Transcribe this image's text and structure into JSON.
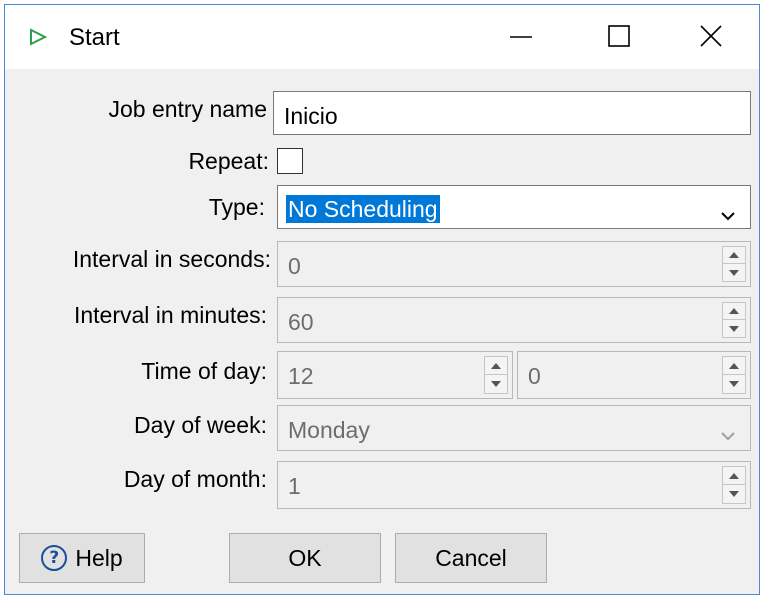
{
  "window": {
    "title": "Start",
    "controls": {
      "minimize": "minimize",
      "maximize": "maximize",
      "close": "close"
    }
  },
  "form": {
    "job_entry_name": {
      "label": "Job entry name",
      "value": "Inicio"
    },
    "repeat": {
      "label": "Repeat:",
      "checked": false
    },
    "type": {
      "label": "Type:",
      "value": "No Scheduling"
    },
    "interval_seconds": {
      "label": "Interval in seconds:",
      "value": "0"
    },
    "interval_minutes": {
      "label": "Interval in minutes:",
      "value": "60"
    },
    "time_of_day": {
      "label": "Time of day:",
      "hour": "12",
      "minute": "0"
    },
    "day_of_week": {
      "label": "Day of week:",
      "value": "Monday"
    },
    "day_of_month": {
      "label": "Day of month:",
      "value": "1"
    }
  },
  "buttons": {
    "help": "Help",
    "ok": "OK",
    "cancel": "Cancel"
  },
  "colors": {
    "selection": "#0078d7",
    "start_icon": "#2aa14a",
    "help_icon": "#1b4f9c"
  }
}
